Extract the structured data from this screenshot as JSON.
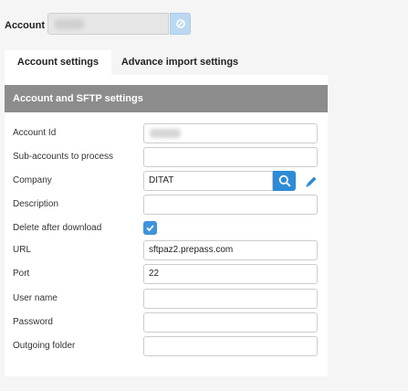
{
  "account": {
    "label": "Account"
  },
  "tabs": [
    {
      "label": "Account settings",
      "active": true
    },
    {
      "label": "Advance import settings",
      "active": false
    }
  ],
  "section": {
    "title": "Account and SFTP settings"
  },
  "fields": {
    "account_id": {
      "label": "Account Id"
    },
    "sub_accounts": {
      "label": "Sub-accounts to process",
      "value": ""
    },
    "company": {
      "label": "Company",
      "value": "DITAT"
    },
    "description": {
      "label": "Description",
      "value": ""
    },
    "delete_after": {
      "label": "Delete after download",
      "checked": true
    },
    "url": {
      "label": "URL",
      "value": "sftpaz2.prepass.com"
    },
    "port": {
      "label": "Port",
      "value": "22"
    },
    "user_name": {
      "label": "User name",
      "value": ""
    },
    "password": {
      "label": "Password",
      "value": ""
    },
    "outgoing_folder": {
      "label": "Outgoing folder",
      "value": ""
    }
  },
  "colors": {
    "accent": "#2e8bd6",
    "header": "#8c8c8c",
    "checkbox": "#3f93dc"
  },
  "icons": [
    "link-icon",
    "search-icon",
    "pencil-icon",
    "check-icon"
  ]
}
